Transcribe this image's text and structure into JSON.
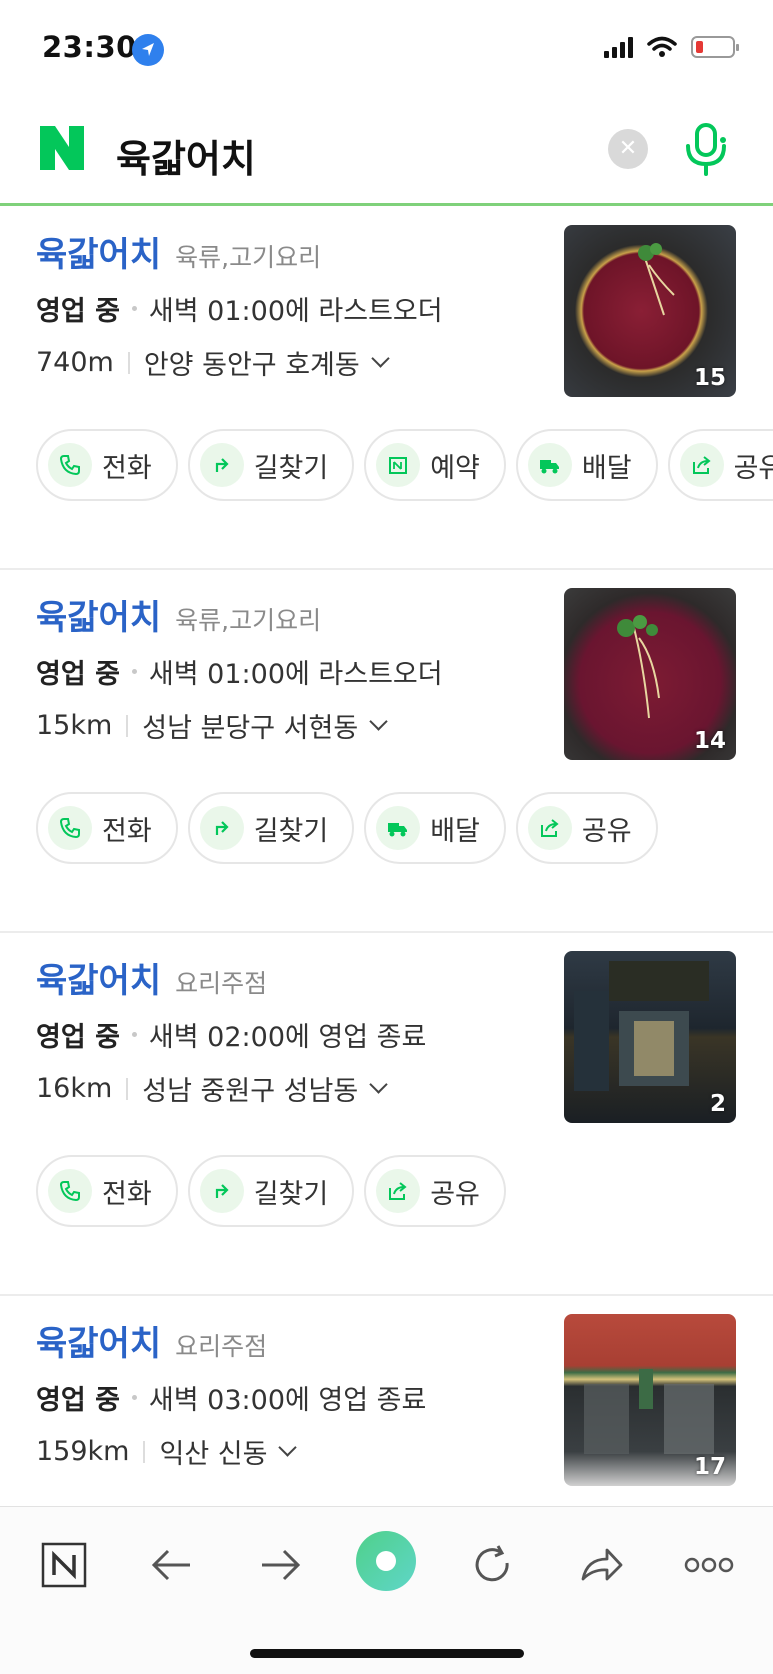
{
  "status_bar": {
    "time": "23:30"
  },
  "search": {
    "query": "육갋어치"
  },
  "results": [
    {
      "name": "육갋어치",
      "category": "육류,고기요리",
      "status": "영업 중",
      "hours": "새벽 01:00에 라스트오더",
      "distance": "740m",
      "address": "안양 동안구 호계동",
      "photo_count": "15",
      "actions": [
        {
          "icon": "phone-icon",
          "label": "전화"
        },
        {
          "icon": "directions-icon",
          "label": "길찾기"
        },
        {
          "icon": "reservation-icon",
          "label": "예약"
        },
        {
          "icon": "delivery-icon",
          "label": "배달"
        },
        {
          "icon": "share-icon",
          "label": "공유"
        }
      ]
    },
    {
      "name": "육갋어치",
      "category": "육류,고기요리",
      "status": "영업 중",
      "hours": "새벽 01:00에 라스트오더",
      "distance": "15km",
      "address": "성남 분당구 서현동",
      "photo_count": "14",
      "actions": [
        {
          "icon": "phone-icon",
          "label": "전화"
        },
        {
          "icon": "directions-icon",
          "label": "길찾기"
        },
        {
          "icon": "delivery-icon",
          "label": "배달"
        },
        {
          "icon": "share-icon",
          "label": "공유"
        }
      ]
    },
    {
      "name": "육갋어치",
      "category": "요리주점",
      "status": "영업 중",
      "hours": "새벽 02:00에 영업 종료",
      "distance": "16km",
      "address": "성남 중원구 성남동",
      "photo_count": "2",
      "actions": [
        {
          "icon": "phone-icon",
          "label": "전화"
        },
        {
          "icon": "directions-icon",
          "label": "길찾기"
        },
        {
          "icon": "share-icon",
          "label": "공유"
        }
      ]
    },
    {
      "name": "육갋어치",
      "category": "요리주점",
      "status": "영업 중",
      "hours": "새벽 03:00에 영업 종료",
      "distance": "159km",
      "address": "익산 신동",
      "photo_count": "17",
      "actions": []
    }
  ],
  "colors": {
    "accent": "#03c75a",
    "title_blue": "#2a63c7"
  },
  "bottom_nav": [
    "naver-home-icon",
    "back-arrow-icon",
    "forward-arrow-icon",
    "green-dot-icon",
    "refresh-icon",
    "share-arrow-icon",
    "more-icon"
  ]
}
